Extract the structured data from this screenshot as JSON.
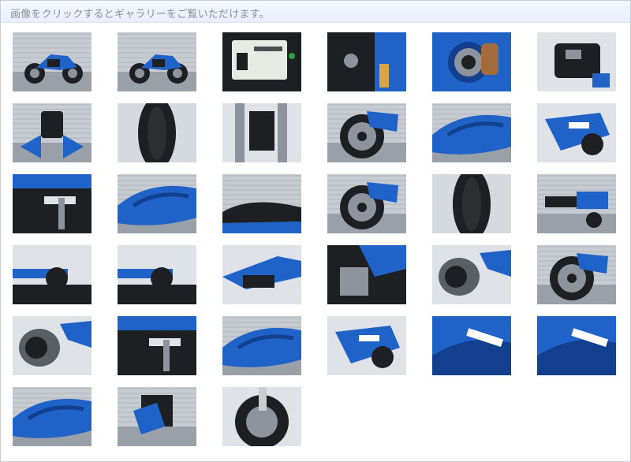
{
  "header": {
    "text": "画像をクリックするとギャラリーをご覧いただけます。"
  },
  "gallery": {
    "rows": 6,
    "cols": 6,
    "items": [
      {
        "alt": "thumbnail-01",
        "kind": "bike-side"
      },
      {
        "alt": "thumbnail-02",
        "kind": "bike-front-side"
      },
      {
        "alt": "thumbnail-03",
        "kind": "meter"
      },
      {
        "alt": "thumbnail-04",
        "kind": "key"
      },
      {
        "alt": "thumbnail-05",
        "kind": "fuel-cap"
      },
      {
        "alt": "thumbnail-06",
        "kind": "seat-under"
      },
      {
        "alt": "thumbnail-07",
        "kind": "front-view"
      },
      {
        "alt": "thumbnail-08",
        "kind": "tire"
      },
      {
        "alt": "thumbnail-09",
        "kind": "fork"
      },
      {
        "alt": "thumbnail-10",
        "kind": "front-wheel"
      },
      {
        "alt": "thumbnail-11",
        "kind": "tank-side"
      },
      {
        "alt": "thumbnail-12",
        "kind": "undercowl"
      },
      {
        "alt": "thumbnail-13",
        "kind": "step"
      },
      {
        "alt": "thumbnail-14",
        "kind": "tank"
      },
      {
        "alt": "thumbnail-15",
        "kind": "seat"
      },
      {
        "alt": "thumbnail-16",
        "kind": "rear-wheel"
      },
      {
        "alt": "thumbnail-17",
        "kind": "tire-rear"
      },
      {
        "alt": "thumbnail-18",
        "kind": "rear-side"
      },
      {
        "alt": "thumbnail-19",
        "kind": "grip"
      },
      {
        "alt": "thumbnail-20",
        "kind": "switch"
      },
      {
        "alt": "thumbnail-21",
        "kind": "tail"
      },
      {
        "alt": "thumbnail-22",
        "kind": "engine"
      },
      {
        "alt": "thumbnail-23",
        "kind": "muffler"
      },
      {
        "alt": "thumbnail-24",
        "kind": "wheel-dark"
      },
      {
        "alt": "thumbnail-25",
        "kind": "muffler-cover"
      },
      {
        "alt": "thumbnail-26",
        "kind": "step-rear"
      },
      {
        "alt": "thumbnail-27",
        "kind": "tank-top"
      },
      {
        "alt": "thumbnail-28",
        "kind": "cowl-suzuki"
      },
      {
        "alt": "thumbnail-29",
        "kind": "suzuki-logo"
      },
      {
        "alt": "thumbnail-30",
        "kind": "gsxs-logo"
      },
      {
        "alt": "thumbnail-31",
        "kind": "tank-closeup"
      },
      {
        "alt": "thumbnail-32",
        "kind": "bike-front"
      },
      {
        "alt": "thumbnail-33",
        "kind": "front-brake"
      }
    ]
  },
  "colors": {
    "blue": "#1f63c9",
    "blue_dark": "#123f8e",
    "grey": "#8e949e",
    "dark": "#1e1f22",
    "light": "#dfe2e7"
  }
}
